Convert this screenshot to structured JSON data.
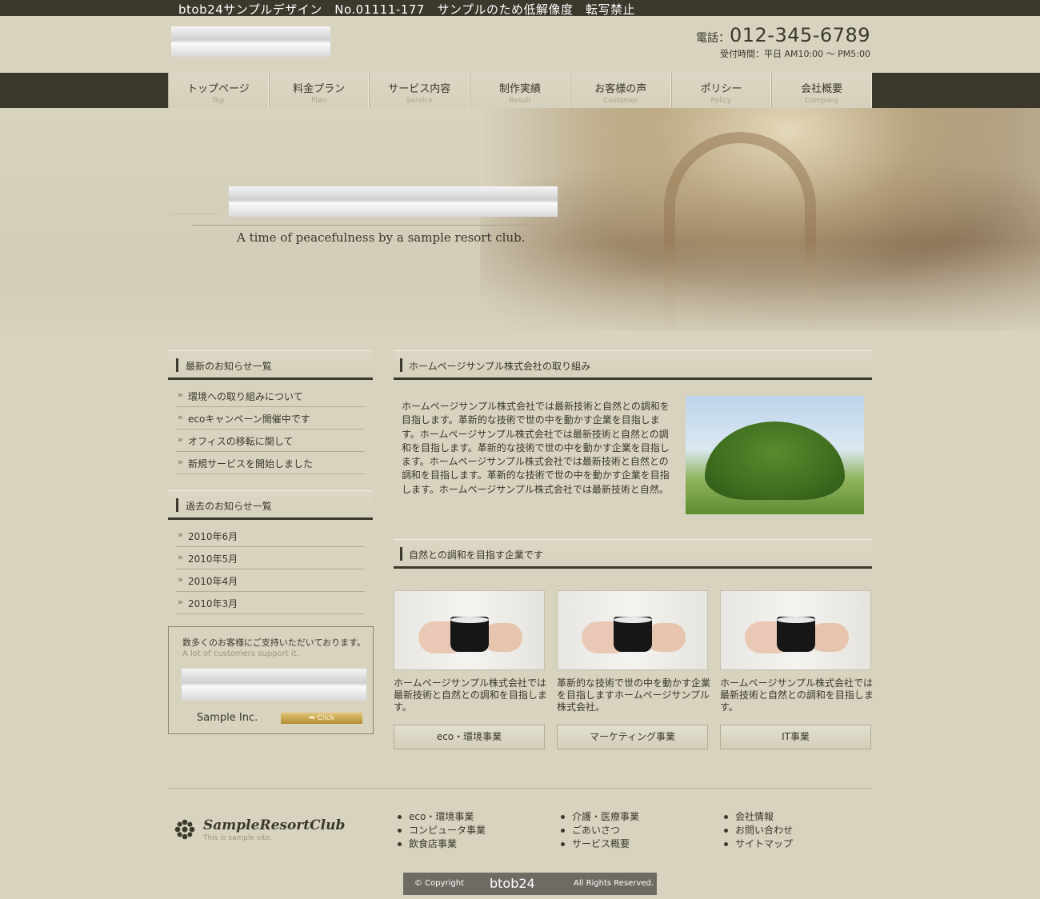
{
  "banner": {
    "text": "btob24サンプルデザイン　No.01111-177　サンプルのため低解像度　転写禁止"
  },
  "header": {
    "tel_label": "電話：",
    "tel_number": "012-345-6789",
    "hours": "受付時間：平日 AM10:00 〜 PM5:00"
  },
  "nav": {
    "items": [
      {
        "jp": "トップページ",
        "en": "Top"
      },
      {
        "jp": "料金プラン",
        "en": "Plan"
      },
      {
        "jp": "サービス内容",
        "en": "Service"
      },
      {
        "jp": "制作実績",
        "en": "Result"
      },
      {
        "jp": "お客様の声",
        "en": "Customer"
      },
      {
        "jp": "ポリシー",
        "en": "Policy"
      },
      {
        "jp": "会社概要",
        "en": "Company"
      }
    ]
  },
  "hero": {
    "tagline": "A time of peacefulness by a sample resort club."
  },
  "sidebar": {
    "news_heading": "最新のお知らせ一覧",
    "news": [
      "環境への取り組みについて",
      "ecoキャンペーン開催中です",
      "オフィスの移転に関して",
      "新規サービスを開始しました"
    ],
    "archive_heading": "過去のお知らせ一覧",
    "archive": [
      "2010年6月",
      "2010年5月",
      "2010年4月",
      "2010年3月"
    ],
    "support": {
      "jp": "数多くのお客様にご支持いただいております。",
      "en": "A lot of customers support it.",
      "company": "Sample Inc.",
      "click": "➡ Click"
    }
  },
  "main": {
    "section1_heading": "ホームページサンプル株式会社の取り組み",
    "intro": "ホームページサンプル株式会社では最新技術と自然との調和を目指します。革新的な技術で世の中を動かす企業を目指します。ホームページサンプル株式会社では最新技術と自然との調和を目指します。革新的な技術で世の中を動かす企業を目指します。ホームページサンプル株式会社では最新技術と自然との調和を目指します。革新的な技術で世の中を動かす企業を目指します。ホームページサンプル株式会社では最新技術と自然。",
    "section2_heading": "自然との調和を目指す企業です",
    "cards": [
      {
        "text": "ホームページサンプル株式会社では最新技術と自然との調和を目指します。",
        "button": "eco・環境事業"
      },
      {
        "text": "革新的な技術で世の中を動かす企業を目指しますホームページサンプル株式会社。",
        "button": "マーケティング事業"
      },
      {
        "text": "ホームページサンプル株式会社では最新技術と自然との調和を目指します。",
        "button": "IT事業"
      }
    ]
  },
  "footer": {
    "brand": "SampleResortClub",
    "brand_sub": "This is sample site.",
    "col1": [
      "eco・環境事業",
      "コンピュータ事業",
      "飲食店事業"
    ],
    "col2": [
      "介護・医療事業",
      "ごあいさつ",
      "サービス概要"
    ],
    "col3": [
      "会社情報",
      "お問い合わせ",
      "サイトマップ"
    ],
    "copyright_left": "© Copyright",
    "copyright_brand": "btob24",
    "copyright_right": "All Rights Reserved."
  },
  "colors": {
    "background": "#d8d3bf",
    "dark": "#3b382c",
    "text": "#3a372c",
    "accent_gold": "#c9a24a"
  }
}
